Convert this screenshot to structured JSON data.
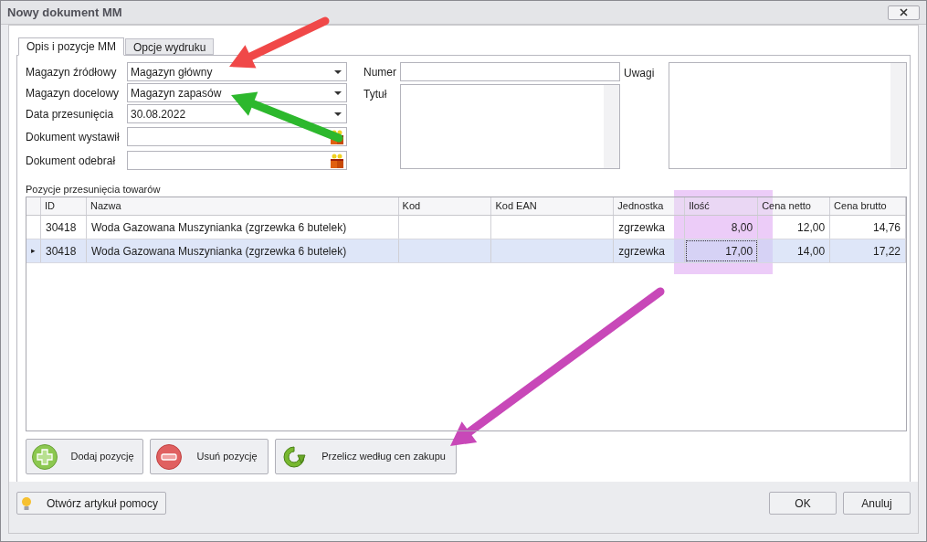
{
  "window": {
    "title": "Nowy dokument MM"
  },
  "tabs": [
    {
      "label": "Opis i pozycje MM",
      "selected": true
    },
    {
      "label": "Opcje wydruku",
      "selected": false
    }
  ],
  "form_left": [
    {
      "label": "Magazyn źródłowy",
      "value": "Magazyn główny",
      "kind": "dropdown"
    },
    {
      "label": "Magazyn docelowy",
      "value": "Magazyn zapasów",
      "kind": "dropdown"
    },
    {
      "label": "Data przesunięcia",
      "value": "30.08.2022",
      "kind": "dropdown"
    },
    {
      "label": "Dokument wystawił",
      "kind": "picker"
    },
    {
      "label": "Dokument odebrał",
      "kind": "picker"
    }
  ],
  "numer": {
    "label": "Numer"
  },
  "tytul": {
    "label": "Tytuł"
  },
  "uwagi": {
    "label": "Uwagi"
  },
  "grid": {
    "title": "Pozycje przesunięcia towarów",
    "columns": [
      "ID",
      "Nazwa",
      "Kod",
      "Kod EAN",
      "Jednostka",
      "Ilość",
      "Cena netto",
      "Cena brutto"
    ],
    "rows": [
      {
        "selected": false,
        "cells": [
          "30418",
          "Woda Gazowana Muszynianka (zgrzewka 6 butelek)",
          "",
          "",
          "zgrzewka",
          "8,00",
          "12,00",
          "14,76"
        ]
      },
      {
        "selected": true,
        "cells": [
          "30418",
          "Woda Gazowana Muszynianka (zgrzewka 6 butelek)",
          "",
          "",
          "zgrzewka",
          "17,00",
          "14,00",
          "17,22"
        ]
      }
    ]
  },
  "row_indicator": "▸",
  "buttons": [
    {
      "label": "Dodaj pozycję",
      "kind": "add"
    },
    {
      "label": "Usuń pozycję",
      "kind": "remove"
    },
    {
      "label": "Przelicz według cen zakupu",
      "kind": "refresh"
    }
  ],
  "help_button": {
    "label": "Otwórz artykuł pomocy"
  },
  "footer_buttons": [
    "OK",
    "Anuluj"
  ],
  "annotations": {
    "arrows": [
      {
        "color": "#f04848"
      },
      {
        "color": "#2db82d"
      },
      {
        "color": "#c848b8"
      }
    ],
    "highlight": {
      "color": "#ecccf8"
    }
  }
}
